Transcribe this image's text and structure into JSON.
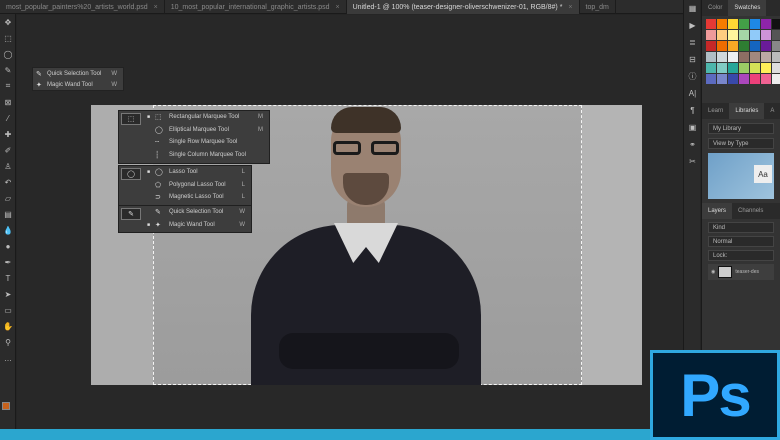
{
  "tabs": [
    {
      "label": "most_popular_painters%20_artists_world.psd",
      "active": false
    },
    {
      "label": "10_most_popular_international_graphic_artists.psd",
      "active": false
    },
    {
      "label": "Unitled-1 @ 100% (teaser-designer-oliverschwenizer-01, RGB/8#) *",
      "active": true
    },
    {
      "label": "top_dm",
      "active": false
    }
  ],
  "toolbar_icons": [
    "move-icon",
    "marquee-icon",
    "lasso-icon",
    "quick-selection-icon",
    "crop-icon",
    "frame-icon",
    "eyedropper-icon",
    "healing-icon",
    "brush-icon",
    "stamp-icon",
    "history-brush-icon",
    "eraser-icon",
    "gradient-icon",
    "blur-icon",
    "dodge-icon",
    "pen-icon",
    "type-icon",
    "path-selection-icon",
    "rectangle-icon",
    "hand-icon",
    "zoom-icon",
    "more-icon"
  ],
  "quick_flyout": {
    "items": [
      {
        "label": "Quick Selection Tool",
        "key": "W"
      },
      {
        "label": "Magic Wand Tool",
        "key": "W"
      }
    ]
  },
  "marquee_group": [
    {
      "label": "Rectangular Marquee Tool",
      "key": "M"
    },
    {
      "label": "Elliptical Marquee Tool",
      "key": "M"
    },
    {
      "label": "Single Row Marquee Tool",
      "key": ""
    },
    {
      "label": "Single Column Marquee Tool",
      "key": ""
    }
  ],
  "lasso_group": [
    {
      "label": "Lasso Tool",
      "key": "L"
    },
    {
      "label": "Polygonal Lasso Tool",
      "key": "L"
    },
    {
      "label": "Magnetic Lasso Tool",
      "key": "L"
    }
  ],
  "selection_group": [
    {
      "label": "Quick Selection Tool",
      "key": "W"
    },
    {
      "label": "Magic Wand Tool",
      "key": "W"
    }
  ],
  "panels": {
    "color_tabs": [
      "Color",
      "Swatches"
    ],
    "library_tabs": [
      "Learn",
      "Libraries",
      "A"
    ],
    "library_select": "My Library",
    "library_view": "View by Type",
    "library_thumb_label": "Aa",
    "layers_tabs": [
      "Layers",
      "Channels"
    ],
    "layers_kind": "Kind",
    "layers_mode": "Normal",
    "layers_lock": "Lock:",
    "layer_name": "teaser-des"
  },
  "swatch_colors": [
    "#e53935",
    "#f57c00",
    "#fdd835",
    "#43a047",
    "#1e88e5",
    "#8e24aa",
    "#111111",
    "#ef9a9a",
    "#ffcc80",
    "#fff59d",
    "#a5d6a7",
    "#90caf9",
    "#ce93d8",
    "#555555",
    "#c62828",
    "#ef6c00",
    "#f9a825",
    "#2e7d32",
    "#1565c0",
    "#6a1b9a",
    "#888888",
    "#b0bec5",
    "#cfd8dc",
    "#eceff1",
    "#8d6e63",
    "#a1887f",
    "#bcaaa4",
    "#bbbbbb",
    "#4db6ac",
    "#80cbc4",
    "#26a69a",
    "#9ccc65",
    "#d4e157",
    "#ffee58",
    "#dddddd",
    "#5c6bc0",
    "#7986cb",
    "#3949ab",
    "#ab47bc",
    "#ec407a",
    "#f06292",
    "#eeeeee"
  ],
  "logo_text": "Ps",
  "accent": "#2ba6cf"
}
